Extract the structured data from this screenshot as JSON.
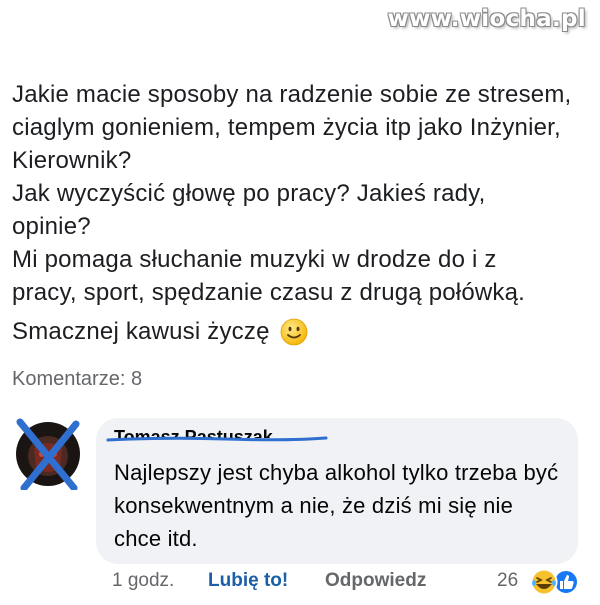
{
  "watermark": "www.wiocha.pl",
  "post": {
    "lines": [
      "Jakie macie sposoby na radzenie sobie ze stresem,",
      "ciaglym gonieniem, tempem życia itp jako Inżynier,",
      "Kierownik?",
      "Jak wyczyścić głowę po pracy? Jakieś rady,",
      "opinie?",
      "Mi pomaga słuchanie muzyki w drodze do i z",
      "pracy, sport, spędzanie czasu z drugą połówką."
    ],
    "closing": "Smacznej kawusi życzę",
    "emoji": "smiling-face-icon"
  },
  "comments_label": "Komentarze: 8",
  "comment": {
    "author": "Tomasz Pastuszak",
    "text": "Najlepszy jest chyba alkohol tylko trzeba być konsekwentnym a nie, że dziś mi się nie chce itd.",
    "time": "1 godz.",
    "like_label": "Lubię to!",
    "reply_label": "Odpowiedz",
    "reaction_count": "26",
    "reactions": [
      "laughing-face-icon",
      "like-thumb-icon"
    ]
  },
  "colors": {
    "link_blue": "#1b5fa8",
    "meta_gray": "#65676b",
    "bubble_bg": "#f0f2f5",
    "censor_blue": "#2f6fd0"
  }
}
